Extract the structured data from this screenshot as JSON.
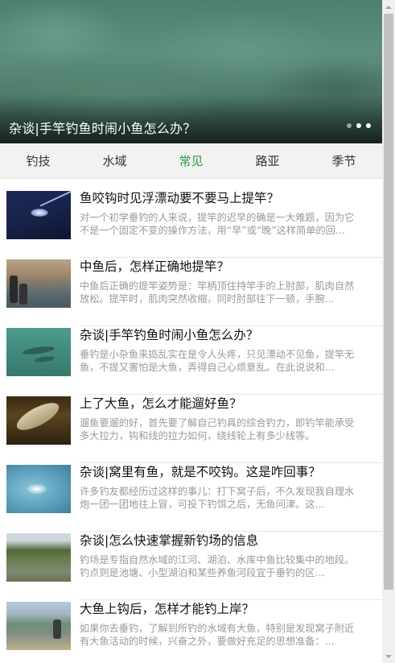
{
  "banner": {
    "caption": "杂谈|手竿钓鱼时闹小鱼怎么办？",
    "dots": 3,
    "active_dot": 1
  },
  "tabs": [
    {
      "label": "钓技",
      "active": false
    },
    {
      "label": "水域",
      "active": false
    },
    {
      "label": "常见",
      "active": true
    },
    {
      "label": "路亚",
      "active": false
    },
    {
      "label": "季节",
      "active": false
    }
  ],
  "articles": [
    {
      "title": "鱼咬钩时见浮漂动要不要马上提竿？",
      "desc": "对一个初学垂钓的人来说，提竿的迟早的确是一大难题，因为它不是一个固定不变的操作方法，用“早”或“晚”这样简单的回…"
    },
    {
      "title": "中鱼后，怎样正确地提竿？",
      "desc": "中鱼后正确的提竿姿势是：竿柄顶住持竿手的上肘部，肌肉自然放松。提竿时，肌肉突然收缩，同时肘部往下一顿，手腕…"
    },
    {
      "title": "杂谈|手竿钓鱼时闹小鱼怎么办？",
      "desc": "垂钓是小杂鱼来捣乱实在是令人头疼，只见漂动不见鱼，提竿无鱼，不提又害怕是大鱼，弄得自己心烦意乱。在此说说和…"
    },
    {
      "title": "上了大鱼，怎么才能遛好鱼？",
      "desc": "遛鱼要遛的好，首先要了解自己钓具的综合钓力，即钓竿能承受多大拉力，钩和线的拉力如何，绕线轮上有多少线等。"
    },
    {
      "title": "杂谈|窝里有鱼，就是不咬钩。这是咋回事？",
      "desc": "许多钓友都经历过这样的事儿：打下窝子后，不久发现我自理水炮一团一团地往上冒，可投下钓饵之后，无鱼问津。这…"
    },
    {
      "title": "杂谈|怎么快速掌握新钓场的信息",
      "desc": "钓场是专指自然水域的江河、湖泊、水库中鱼比较集中的地段。钓点则是池塘、小型湖泊和某些养鱼河段宜于垂钓的区…"
    },
    {
      "title": "大鱼上钩后，怎样才能钓上岸？",
      "desc": "如果你去垂钓，了解到所钓的水域有大鱼，特别是发现窝子附近有大鱼活动的时候，兴奋之外，要做好充足的思想准备：…"
    }
  ],
  "colors": {
    "active_tab": "#2e9a3c",
    "tab_bar_bg": "#f2f2f2",
    "title_text": "#111111",
    "desc_text": "#999999"
  }
}
